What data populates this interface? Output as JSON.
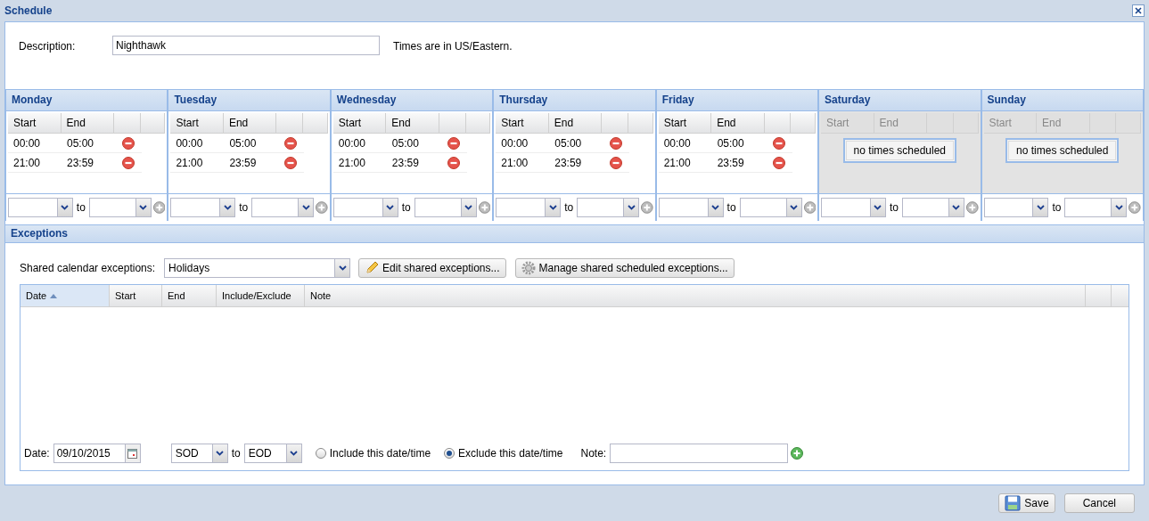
{
  "window": {
    "title": "Schedule"
  },
  "description": {
    "label": "Description:",
    "value": "Nighthawk",
    "note": "Times are in US/Eastern."
  },
  "days": [
    {
      "name": "Monday",
      "enabled": true,
      "columns": [
        "Start",
        "End"
      ],
      "rows": [
        {
          "start": "00:00",
          "end": "05:00"
        },
        {
          "start": "21:00",
          "end": "23:59"
        }
      ],
      "to_label": "to"
    },
    {
      "name": "Tuesday",
      "enabled": true,
      "columns": [
        "Start",
        "End"
      ],
      "rows": [
        {
          "start": "00:00",
          "end": "05:00"
        },
        {
          "start": "21:00",
          "end": "23:59"
        }
      ],
      "to_label": "to"
    },
    {
      "name": "Wednesday",
      "enabled": true,
      "columns": [
        "Start",
        "End"
      ],
      "rows": [
        {
          "start": "00:00",
          "end": "05:00"
        },
        {
          "start": "21:00",
          "end": "23:59"
        }
      ],
      "to_label": "to"
    },
    {
      "name": "Thursday",
      "enabled": true,
      "columns": [
        "Start",
        "End"
      ],
      "rows": [
        {
          "start": "00:00",
          "end": "05:00"
        },
        {
          "start": "21:00",
          "end": "23:59"
        }
      ],
      "to_label": "to"
    },
    {
      "name": "Friday",
      "enabled": true,
      "columns": [
        "Start",
        "End"
      ],
      "rows": [
        {
          "start": "00:00",
          "end": "05:00"
        },
        {
          "start": "21:00",
          "end": "23:59"
        }
      ],
      "to_label": "to"
    },
    {
      "name": "Saturday",
      "enabled": false,
      "columns": [
        "Start",
        "End"
      ],
      "empty_text": "no times scheduled",
      "to_label": "to"
    },
    {
      "name": "Sunday",
      "enabled": false,
      "columns": [
        "Start",
        "End"
      ],
      "empty_text": "no times scheduled",
      "to_label": "to"
    }
  ],
  "exceptions": {
    "title": "Exceptions",
    "shared_label": "Shared calendar exceptions:",
    "shared_value": "Holidays",
    "buttons": [
      {
        "kind": "edit",
        "label": "Edit shared exceptions..."
      },
      {
        "kind": "manage",
        "label": "Manage shared scheduled exceptions..."
      }
    ],
    "columns": [
      {
        "label": "Date",
        "sorted": true
      },
      {
        "label": "Start",
        "sorted": false
      },
      {
        "label": "End",
        "sorted": false
      },
      {
        "label": "Include/Exclude",
        "sorted": false
      },
      {
        "label": "Note",
        "sorted": false
      }
    ],
    "form": {
      "date_label": "Date:",
      "date_value": "09/10/2015",
      "from": "SOD",
      "to_label": "to",
      "to": "EOD",
      "radios": [
        {
          "label": "Include this date/time",
          "selected": false
        },
        {
          "label": "Exclude this date/time",
          "selected": true
        }
      ],
      "note_label": "Note:"
    }
  },
  "footer": {
    "buttons": [
      {
        "kind": "save",
        "label": "Save"
      },
      {
        "kind": "cancel",
        "label": "Cancel"
      }
    ]
  }
}
